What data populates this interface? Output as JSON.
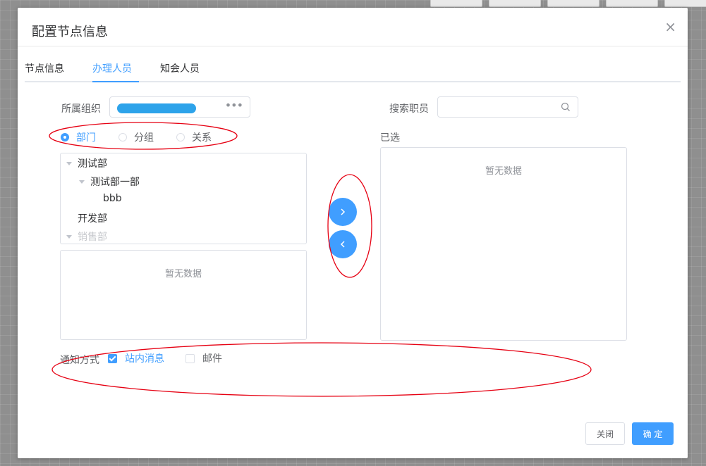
{
  "dialog": {
    "title": "配置节点信息",
    "close_glyph": "×"
  },
  "tabs": [
    {
      "label": "节点信息",
      "active": false
    },
    {
      "label": "办理人员",
      "active": true
    },
    {
      "label": "知会人员",
      "active": false
    }
  ],
  "org": {
    "label": "所属组织",
    "value": "",
    "more_glyph": "•••"
  },
  "search": {
    "label": "搜索职员",
    "placeholder": ""
  },
  "radios": [
    {
      "label": "部门",
      "selected": true
    },
    {
      "label": "分组",
      "selected": false
    },
    {
      "label": "关系",
      "selected": false
    }
  ],
  "tree": {
    "nodes": [
      {
        "label": "测试部",
        "expanded": true
      },
      {
        "label": "测试部一部",
        "expanded": true
      },
      {
        "label": "bbb"
      },
      {
        "label": "开发部"
      },
      {
        "label": "销售部",
        "expanded": true
      }
    ]
  },
  "employees": {
    "empty_text": "暂无数据"
  },
  "selected": {
    "label": "已选",
    "empty_text": "暂无数据"
  },
  "transfer": {
    "right_glyph": "chevron-right-icon",
    "left_glyph": "chevron-left-icon"
  },
  "notify": {
    "label": "通知方式",
    "options": [
      {
        "label": "站内消息",
        "checked": true
      },
      {
        "label": "邮件",
        "checked": false
      }
    ]
  },
  "footer": {
    "close_label": "关闭",
    "confirm_label": "确 定"
  },
  "colors": {
    "primary": "#409eff",
    "annotation": "#e60012",
    "mask": "#8f8f8f"
  }
}
